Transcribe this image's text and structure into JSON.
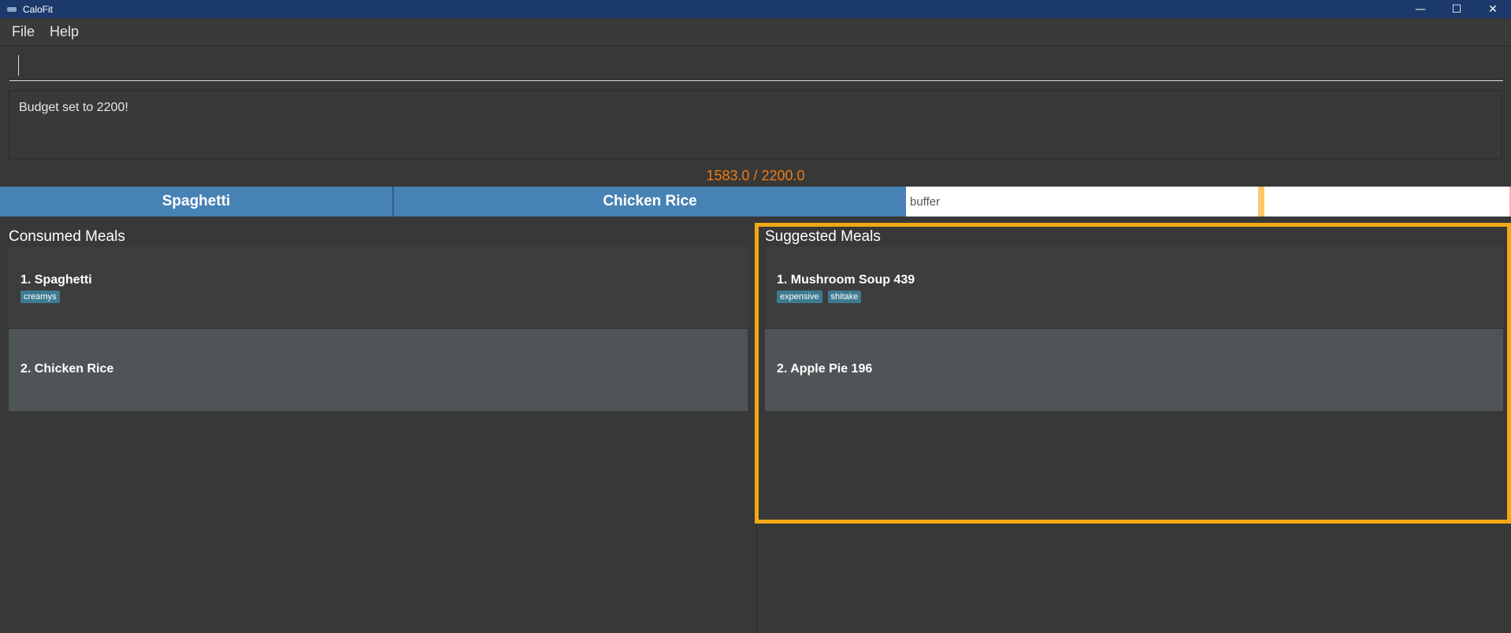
{
  "window": {
    "title": "CaloFit",
    "controls": {
      "minimize": "—",
      "maximize": "☐",
      "close": "✕"
    }
  },
  "menu": {
    "items": [
      "File",
      "Help"
    ]
  },
  "command": {
    "value": "",
    "placeholder": ""
  },
  "result": {
    "text": "Budget set to 2200!"
  },
  "calories": {
    "text": "1583.0 / 2200.0",
    "consumed": 1583.0,
    "budget": 2200.0,
    "color": "#f07a14"
  },
  "progress": {
    "segments": [
      "Spaghetti",
      "Chicken Rice"
    ],
    "buffer_label": "buffer",
    "segment_color": "#4682b4"
  },
  "consumed": {
    "title": "Consumed Meals",
    "items": [
      {
        "label": "1.  Spaghetti",
        "tags": [
          "creamys"
        ]
      },
      {
        "label": "2.  Chicken Rice",
        "tags": []
      }
    ]
  },
  "suggested": {
    "title": "Suggested Meals",
    "items": [
      {
        "label": "1.  Mushroom Soup  439",
        "tags": [
          "expensive",
          "shitake"
        ]
      },
      {
        "label": "2.  Apple Pie  196",
        "tags": []
      }
    ],
    "highlight_color": "#f2a814"
  }
}
